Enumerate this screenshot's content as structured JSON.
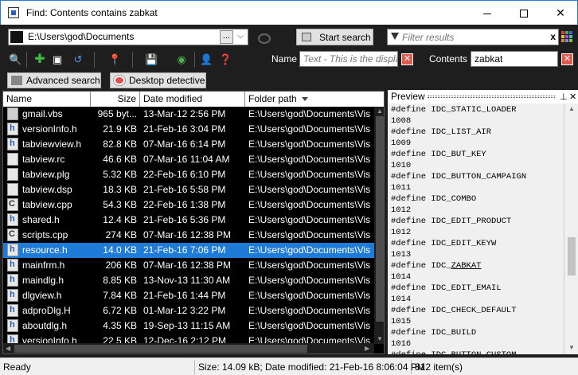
{
  "window": {
    "title": "Find: Contents contains zabkat"
  },
  "toolbar": {
    "path": "E:\\Users\\god\\Documents",
    "browse_label": "...",
    "start_search": "Start search",
    "filter_placeholder": "Filter results",
    "clear_glyph": "x"
  },
  "search_bar": {
    "name_label": "Name",
    "name_placeholder": "Text - This is the displa",
    "contents_label": "Contents",
    "contents_value": "zabkat"
  },
  "actions": {
    "advanced": "Advanced search",
    "desktop": "Desktop detective"
  },
  "list": {
    "columns": [
      "Name",
      "Size",
      "Date modified",
      "Folder path"
    ],
    "rows": [
      {
        "name": "gmail.vbs",
        "size": "965 byt...",
        "date": "13-Mar-12 2:56 PM",
        "path": "E:\\Users\\god\\Documents\\Vis",
        "icon": "vbs"
      },
      {
        "name": "versionInfo.h",
        "size": "21.9 KB",
        "date": "21-Feb-16 3:04 PM",
        "path": "E:\\Users\\god\\Documents\\Vis",
        "icon": "h"
      },
      {
        "name": "tabviewview.h",
        "size": "82.8 KB",
        "date": "07-Mar-16 6:14 PM",
        "path": "E:\\Users\\god\\Documents\\Vis",
        "icon": "h"
      },
      {
        "name": "tabview.rc",
        "size": "46.6 KB",
        "date": "07-Mar-16 11:04 AM",
        "path": "E:\\Users\\god\\Documents\\Vis",
        "icon": "rc"
      },
      {
        "name": "tabview.plg",
        "size": "5.32 KB",
        "date": "22-Feb-16 6:10 PM",
        "path": "E:\\Users\\god\\Documents\\Vis",
        "icon": "plg"
      },
      {
        "name": "tabview.dsp",
        "size": "18.3 KB",
        "date": "21-Feb-16 5:58 PM",
        "path": "E:\\Users\\god\\Documents\\Vis",
        "icon": "dsp"
      },
      {
        "name": "tabview.cpp",
        "size": "54.3 KB",
        "date": "22-Feb-16 1:38 PM",
        "path": "E:\\Users\\god\\Documents\\Vis",
        "icon": "cpp"
      },
      {
        "name": "shared.h",
        "size": "12.4 KB",
        "date": "21-Feb-16 5:36 PM",
        "path": "E:\\Users\\god\\Documents\\Vis",
        "icon": "h"
      },
      {
        "name": "scripts.cpp",
        "size": "274 KB",
        "date": "07-Mar-16 12:38 PM",
        "path": "E:\\Users\\god\\Documents\\Vis",
        "icon": "cpp"
      },
      {
        "name": "resource.h",
        "size": "14.0 KB",
        "date": "21-Feb-16 7:06 PM",
        "path": "E:\\Users\\god\\Documents\\Vis",
        "icon": "h",
        "selected": true
      },
      {
        "name": "mainfrm.h",
        "size": "206 KB",
        "date": "07-Mar-16 12:38 PM",
        "path": "E:\\Users\\god\\Documents\\Vis",
        "icon": "h"
      },
      {
        "name": "maindlg.h",
        "size": "8.85 KB",
        "date": "13-Nov-13 11:30 AM",
        "path": "E:\\Users\\god\\Documents\\Vis",
        "icon": "h"
      },
      {
        "name": "dlgview.h",
        "size": "7.84 KB",
        "date": "21-Feb-16 1:44 PM",
        "path": "E:\\Users\\god\\Documents\\Vis",
        "icon": "h"
      },
      {
        "name": "adproDlg.H",
        "size": "6.72 KB",
        "date": "01-Mar-12 3:22 PM",
        "path": "E:\\Users\\god\\Documents\\Vis",
        "icon": "h"
      },
      {
        "name": "aboutdlg.h",
        "size": "4.35 KB",
        "date": "19-Sep-13 11:15 AM",
        "path": "E:\\Users\\god\\Documents\\Vis",
        "icon": "h"
      },
      {
        "name": "versionInfo.h",
        "size": "22.5 KB",
        "date": "12-Dec-16 2:12 PM",
        "path": "E:\\Users\\god\\Documents\\Vis",
        "icon": "h"
      }
    ]
  },
  "preview": {
    "title": "Preview",
    "lines": [
      "#define IDC_STATIC_LOADER",
      "1008",
      "#define IDC_LIST_AIR",
      "1009",
      "#define IDC_BUT_KEY",
      "1010",
      "#define IDC_BUTTON_CAMPAIGN",
      "1011",
      "#define IDC_COMBO",
      "1012",
      "#define IDC_EDIT_PRODUCT",
      "1012",
      "#define IDC_EDIT_KEYW",
      "1013",
      "#define IDC_ZABKAT",
      "1014",
      "#define IDC_EDIT_EMAIL",
      "1014",
      "#define IDC_CHECK_DEFAULT",
      "1015",
      "#define IDC_BUILD",
      "1016",
      "#define IDC_BUTTON_CUSTOM"
    ],
    "highlight_word": "ZABKAT"
  },
  "status": {
    "ready": "Ready",
    "detail": "Size: 14.09 kB; Date modified: 21-Feb-16 8:06:04 PM",
    "count": "812 item(s)"
  },
  "colors": {
    "selection": "#1e7bd7",
    "background": "#1e1e1e",
    "clear_button": "#e05a4f"
  }
}
